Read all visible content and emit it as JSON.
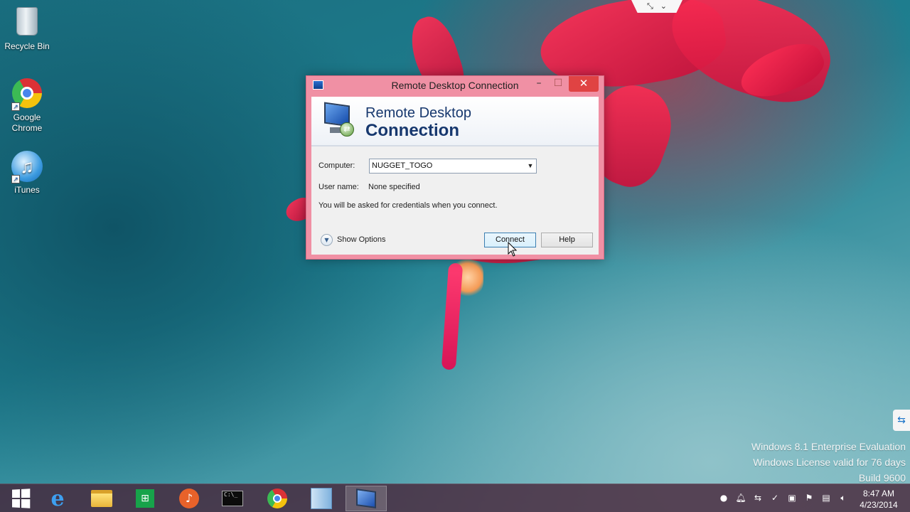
{
  "desktop_icons": [
    {
      "label": "Recycle Bin"
    },
    {
      "label": "Google\nChrome"
    },
    {
      "label": "iTunes"
    }
  ],
  "dialog": {
    "title": "Remote Desktop Connection",
    "minimize_glyph": "–",
    "maximize_glyph": "☐",
    "close_glyph": "✕",
    "banner_line1": "Remote Desktop",
    "banner_line2": "Connection",
    "computer_label": "Computer:",
    "computer_value": "NUGGET_TOGO",
    "username_label": "User name:",
    "username_value": "None specified",
    "credentials_note": "You will be asked for credentials when you connect.",
    "show_options_label": "Show Options",
    "connect_label": "Connect",
    "help_label": "Help"
  },
  "watermark": {
    "line1": "Windows 8.1 Enterprise Evaluation",
    "line2": "Windows License valid for 76 days",
    "line3": "Build 9600"
  },
  "taskbar": {
    "apps": [
      "start",
      "internet-explorer",
      "file-explorer",
      "store",
      "audio-app",
      "command-prompt",
      "google-chrome",
      "server-manager",
      "remote-desktop"
    ],
    "active_app": "remote-desktop",
    "clock_time": "8:47 AM",
    "clock_date": "4/23/2014"
  },
  "colors": {
    "title_bar": "#f090a4",
    "close_button": "#e04343",
    "taskbar": "#46203a",
    "banner_text": "#17386e"
  }
}
